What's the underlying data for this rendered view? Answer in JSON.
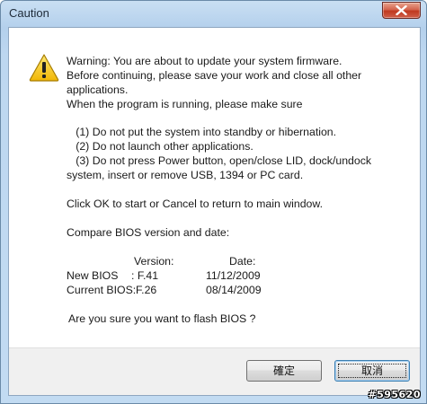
{
  "window": {
    "title": "Caution",
    "close_icon": "close-x-icon"
  },
  "message": {
    "icon": "warning-triangle-icon",
    "lines": [
      "Warning: You are about to update your system firmware.",
      "Before continuing, please save your work and close all other",
      "applications.",
      "When the program is running, please make sure",
      "",
      "   (1) Do not put the system into standby or hibernation.",
      "   (2) Do not launch other applications.",
      "   (3) Do not press Power button, open/close LID, dock/undock",
      "system, insert or remove USB, 1394 or PC card.",
      "",
      "Click OK to start or Cancel to return to main window.",
      "",
      "Compare BIOS version and date:"
    ],
    "bios_table": {
      "header_version": "Version:",
      "header_date": "Date:",
      "rows": [
        {
          "label": "New BIOS",
          "version": ": F.41",
          "date": "11/12/2009"
        },
        {
          "label": "Current BIOS:",
          "version": "F.26",
          "date": "08/14/2009"
        }
      ]
    },
    "question": "Are you sure you want to flash BIOS ?"
  },
  "buttons": {
    "ok_label": "確定",
    "cancel_label": "取消"
  },
  "watermark": "#595620"
}
